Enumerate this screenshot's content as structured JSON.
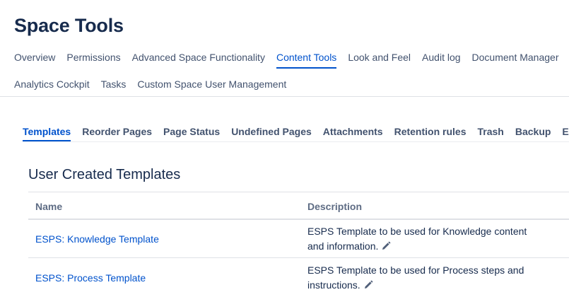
{
  "page": {
    "title": "Space Tools"
  },
  "nav": {
    "row1": [
      {
        "label": "Overview"
      },
      {
        "label": "Permissions"
      },
      {
        "label": "Advanced Space Functionality"
      },
      {
        "label": "Content Tools",
        "active": true
      },
      {
        "label": "Look and Feel"
      },
      {
        "label": "Audit log"
      },
      {
        "label": "Document Manager"
      }
    ],
    "row2": [
      {
        "label": "Analytics Cockpit"
      },
      {
        "label": "Tasks"
      },
      {
        "label": "Custom Space User Management"
      }
    ]
  },
  "subtabs": [
    {
      "label": "Templates",
      "active": true
    },
    {
      "label": "Reorder Pages"
    },
    {
      "label": "Page Status"
    },
    {
      "label": "Undefined Pages"
    },
    {
      "label": "Attachments"
    },
    {
      "label": "Retention rules"
    },
    {
      "label": "Trash"
    },
    {
      "label": "Backup"
    },
    {
      "label": "Export"
    }
  ],
  "section": {
    "title": "User Created Templates"
  },
  "table": {
    "headers": {
      "name": "Name",
      "description": "Description"
    },
    "rows": [
      {
        "name": "ESPS: Knowledge Template",
        "description": "ESPS Template to be used for Knowledge content and information."
      },
      {
        "name": "ESPS: Process Template",
        "description": "ESPS Template to be used for Process steps and instructions."
      }
    ]
  },
  "icons": {
    "edit": "pencil-icon"
  },
  "colors": {
    "accent": "#0052cc",
    "text": "#172b4d",
    "muted": "#42526e"
  }
}
